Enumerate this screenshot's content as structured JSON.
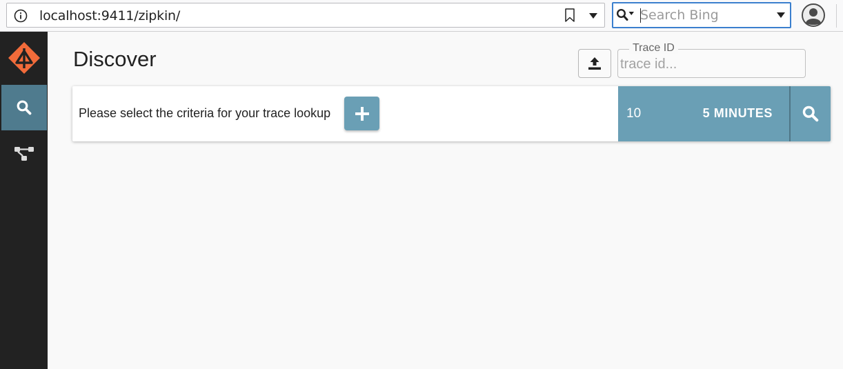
{
  "browser": {
    "url": "localhost:9411/zipkin/",
    "search_placeholder": "Search Bing"
  },
  "sidebar": {
    "items": [
      {
        "name": "discover",
        "icon": "search-icon",
        "active": true
      },
      {
        "name": "dependencies",
        "icon": "dependency-tree-icon",
        "active": false
      }
    ]
  },
  "page": {
    "title": "Discover"
  },
  "trace_id": {
    "label": "Trace ID",
    "placeholder": "trace id..."
  },
  "criteria": {
    "prompt": "Please select the criteria for your trace lookup",
    "limit": "10",
    "lookback": "5 MINUTES"
  },
  "colors": {
    "accent": "#6a9fb5",
    "sidebar_bg": "#222222",
    "sidebar_active": "#4f7b8e",
    "logo": "#f26b3a"
  }
}
